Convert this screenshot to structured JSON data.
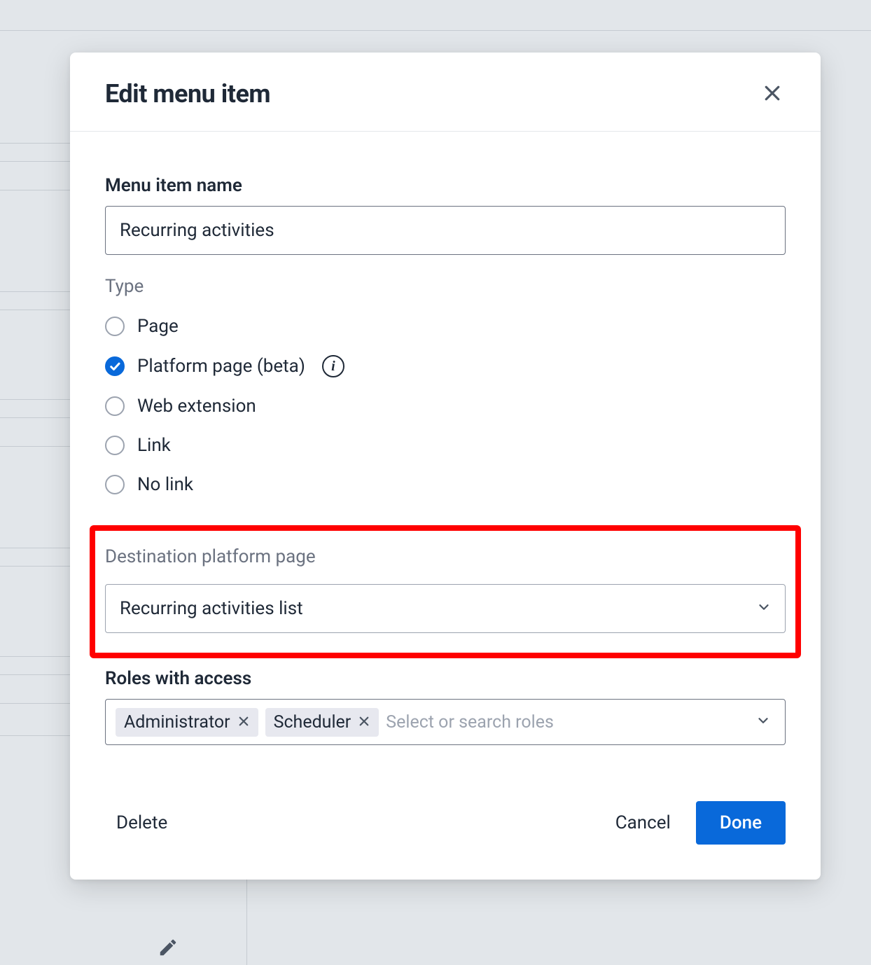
{
  "modal": {
    "title": "Edit menu item",
    "name_label": "Menu item name",
    "name_value": "Recurring activities",
    "type_label": "Type",
    "type_options": {
      "page": "Page",
      "platform_page": "Platform page (beta)",
      "web_extension": "Web extension",
      "link": "Link",
      "no_link": "No link"
    },
    "destination_label": "Destination platform page",
    "destination_value": "Recurring activities list",
    "roles_label": "Roles with access",
    "roles_selected": [
      "Administrator",
      "Scheduler"
    ],
    "roles_placeholder": "Select or search roles",
    "footer": {
      "delete": "Delete",
      "cancel": "Cancel",
      "done": "Done"
    }
  }
}
